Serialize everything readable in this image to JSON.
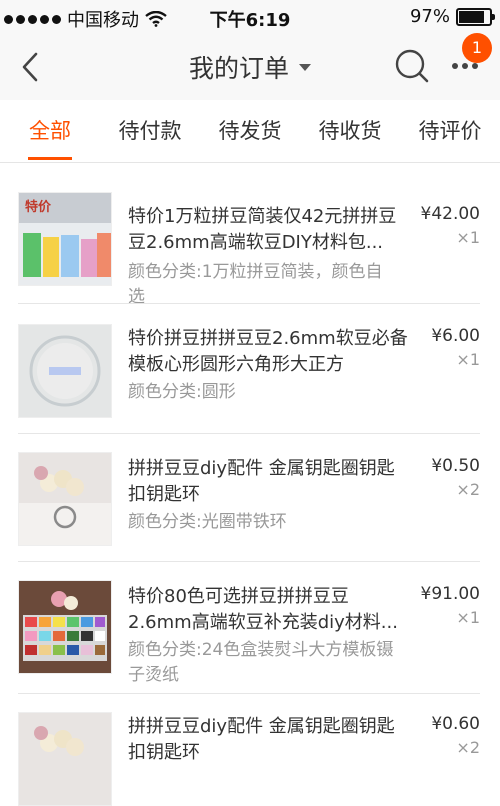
{
  "status_bar": {
    "carrier": "中国移动",
    "time": "下午6:19",
    "battery": "97%",
    "battery_level": 0.97
  },
  "nav": {
    "title": "我的订单",
    "notification_count": "1"
  },
  "tabs": [
    {
      "label": "全部",
      "active": true
    },
    {
      "label": "待付款",
      "active": false
    },
    {
      "label": "待发货",
      "active": false
    },
    {
      "label": "待收货",
      "active": false
    },
    {
      "label": "待评价",
      "active": false
    }
  ],
  "colors": {
    "accent": "#ff5000",
    "text": "#333333",
    "muted": "#999999"
  },
  "orders": [
    {
      "title": "特价1万粒拼豆简装仅42元拼拼豆豆2.6mm高端软豆DIY材料包...",
      "spec": "颜色分类:1万粒拼豆简装，颜色自选",
      "price": "¥42.00",
      "qty": "×1",
      "thumb_label": "特价"
    },
    {
      "title": "特价拼豆拼拼豆豆2.6mm软豆必备模板心形圆形六角形大正方",
      "spec": "颜色分类:圆形",
      "price": "¥6.00",
      "qty": "×1"
    },
    {
      "title": "拼拼豆豆diy配件 金属钥匙圈钥匙扣钥匙环",
      "spec": "颜色分类:光圈带铁环",
      "price": "¥0.50",
      "qty": "×2"
    },
    {
      "title": "特价80色可选拼豆拼拼豆豆2.6mm高端软豆补充装diy材料...",
      "spec": "颜色分类:24色盒装熨斗大方模板镊子烫纸",
      "price": "¥91.00",
      "qty": "×1"
    },
    {
      "title": "拼拼豆豆diy配件 金属钥匙圈钥匙扣钥匙环",
      "spec": "",
      "price": "¥0.60",
      "qty": "×2"
    }
  ]
}
